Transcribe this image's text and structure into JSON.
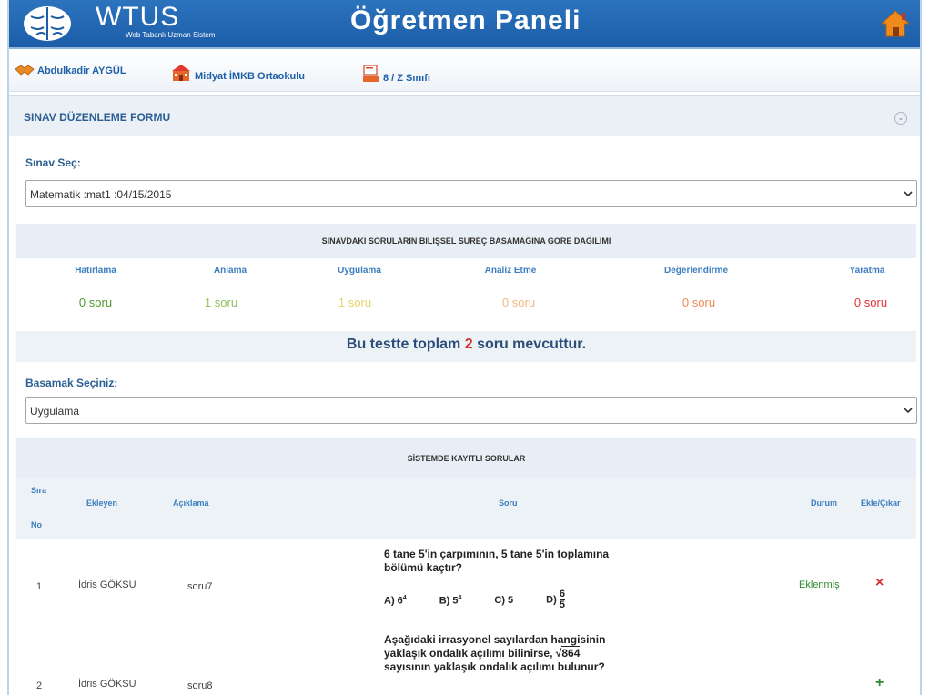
{
  "header": {
    "brand": "WTUS",
    "brand_sub": "Web Tabanlı Uzman Sistem",
    "title": "Öğretmen Paneli"
  },
  "info": {
    "teacher": "Abdulkadir AYGÜL",
    "school": "Midyat İMKB Ortaokulu",
    "class": "8 / Z Sınıfı"
  },
  "form": {
    "title": "SINAV DÜZENLEME FORMU",
    "exam_label": "Sınav Seç:",
    "exam_value": "Matematik :mat1 :04/15/2015"
  },
  "distribution": {
    "title": "SINAVDAKİ SORULARIN BİLİŞSEL SÜREÇ BASAMAĞINA GÖRE DAĞILIMI",
    "headers": [
      "Hatırlama",
      "Anlama",
      "Uygulama",
      "Analiz Etme",
      "Değerlendirme",
      "Yaratma"
    ],
    "values": [
      "0 soru",
      "1 soru",
      "1 soru",
      "0 soru",
      "0 soru",
      "0 soru"
    ],
    "colors": [
      "#4e9a2b",
      "#8fc25a",
      "#e7d36a",
      "#f2b880",
      "#ee8a55",
      "#e0343a"
    ]
  },
  "total": {
    "prefix": "Bu testte toplam",
    "count": "2",
    "suffix": "soru mevcuttur."
  },
  "level": {
    "label": "Basamak Seçiniz:",
    "value": "Uygulama"
  },
  "questions": {
    "title": "SİSTEMDE KAYITLI SORULAR",
    "headers": {
      "no_1": "Sıra",
      "no_2": "No",
      "added_by": "Ekleyen",
      "desc": "Açıklama",
      "question": "Soru",
      "status": "Durum",
      "action": "Ekle/Çıkar"
    },
    "rows": [
      {
        "no": "1",
        "added_by": "İdris GÖKSU",
        "desc": "soru7",
        "text_1": "6 tane 5'in çarpımının, 5 tane 5'in toplamına",
        "text_2": "bölümü kaçtır?",
        "opt_a": "A) 6",
        "opt_a_sup": "4",
        "opt_b": "B) 5",
        "opt_b_sup": "4",
        "opt_c": "C) 5",
        "opt_d": "D)",
        "opt_d_num": "6",
        "opt_d_den": "5",
        "status": "Eklenmiş",
        "action": "×"
      },
      {
        "no": "2",
        "added_by": "İdris GÖKSU",
        "desc": "soru8",
        "text_1": "Aşağıdaki irrasyonel sayılardan hangisinin",
        "text_2": "yaklaşık ondalık açılımı bilinirse,",
        "sqrt": "864",
        "text_3": "sayısının yaklaşık ondalık açılımı bulunur?",
        "status": "",
        "action": "+"
      }
    ]
  }
}
